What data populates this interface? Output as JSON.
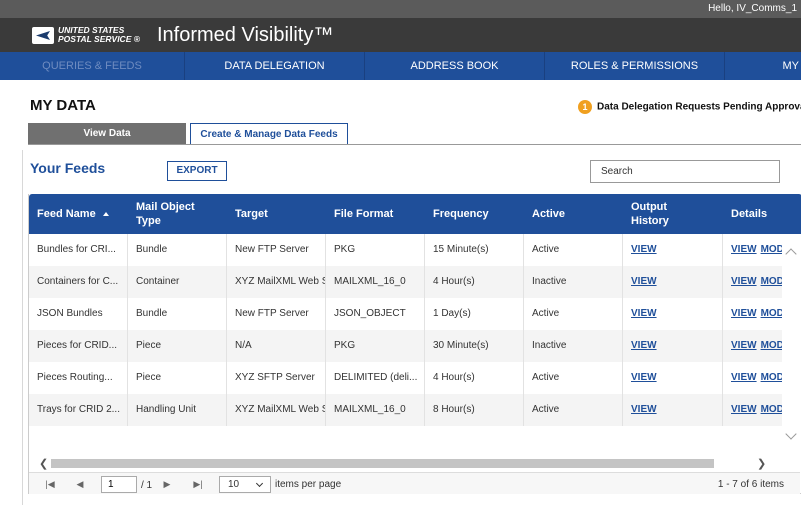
{
  "greeting": "Hello, IV_Comms_1",
  "logo": {
    "line1": "UNITED STATES",
    "line2": "POSTAL SERVICE ®"
  },
  "app_title": "Informed Visibility™",
  "nav": [
    {
      "label": "QUERIES & FEEDS",
      "dim": true
    },
    {
      "label": "DATA DELEGATION"
    },
    {
      "label": "ADDRESS BOOK"
    },
    {
      "label": "ROLES & PERMISSIONS"
    },
    {
      "label": "MY"
    }
  ],
  "page_title": "MY DATA",
  "pending": {
    "count": "1",
    "text": "Data Delegation Requests Pending Approval"
  },
  "tabs": {
    "view": "View Data",
    "create": "Create & Manage Data Feeds"
  },
  "feeds_title": "Your Feeds",
  "export_label": "EXPORT",
  "search_placeholder": "Search",
  "columns": [
    "Feed Name",
    "Mail Object Type",
    "Target",
    "File Format",
    "Frequency",
    "Active",
    "Output History",
    "Details"
  ],
  "column_lines": [
    [
      "Feed Name"
    ],
    [
      "Mail Object",
      "Type"
    ],
    [
      "Target"
    ],
    [
      "File Format"
    ],
    [
      "Frequency"
    ],
    [
      "Active"
    ],
    [
      "Output",
      "History"
    ],
    [
      "Details"
    ]
  ],
  "rows": [
    {
      "feed": "Bundles for CRI...",
      "type": "Bundle",
      "target": "New FTP Server",
      "format": "PKG",
      "freq": "15 Minute(s)",
      "active": "Active",
      "history": "VIEW",
      "view": "VIEW",
      "mod": "MOD"
    },
    {
      "feed": "Containers for C...",
      "type": "Container",
      "target": "XYZ MailXML Web Se",
      "format": "MAILXML_16_0",
      "freq": "4 Hour(s)",
      "active": "Inactive",
      "history": "VIEW",
      "view": "VIEW",
      "mod": "MOD"
    },
    {
      "feed": "JSON Bundles",
      "type": "Bundle",
      "target": "New FTP Server",
      "format": "JSON_OBJECT",
      "freq": "1 Day(s)",
      "active": "Active",
      "history": "VIEW",
      "view": "VIEW",
      "mod": "MOD"
    },
    {
      "feed": "Pieces for CRID...",
      "type": "Piece",
      "target": "N/A",
      "format": "PKG",
      "freq": "30 Minute(s)",
      "active": "Inactive",
      "history": "VIEW",
      "view": "VIEW",
      "mod": "MOD"
    },
    {
      "feed": "Pieces Routing...",
      "type": "Piece",
      "target": "XYZ SFTP Server",
      "format": "DELIMITED (deli...",
      "freq": "4 Hour(s)",
      "active": "Active",
      "history": "VIEW",
      "view": "VIEW",
      "mod": "MOD"
    },
    {
      "feed": "Trays for CRID 2...",
      "type": "Handling Unit",
      "target": "XYZ MailXML Web Se",
      "format": "MAILXML_16_0",
      "freq": "8 Hour(s)",
      "active": "Active",
      "history": "VIEW",
      "view": "VIEW",
      "mod": "MOD"
    }
  ],
  "pager": {
    "page": "1",
    "of": "/ 1",
    "per_page": "10",
    "per_page_label": "items per page",
    "info": "1 - 7 of 6 items"
  },
  "icons": [
    "eagle-logo-icon",
    "sort-asc-icon",
    "scroll-up-icon",
    "scroll-down-icon",
    "scroll-left-icon",
    "scroll-right-icon",
    "first-page-icon",
    "prev-page-icon",
    "next-page-icon",
    "last-page-icon",
    "chevron-down-icon"
  ],
  "colors": {
    "primary": "#1f4f9a",
    "header": "#3a3a3a",
    "badge": "#f0a020"
  }
}
